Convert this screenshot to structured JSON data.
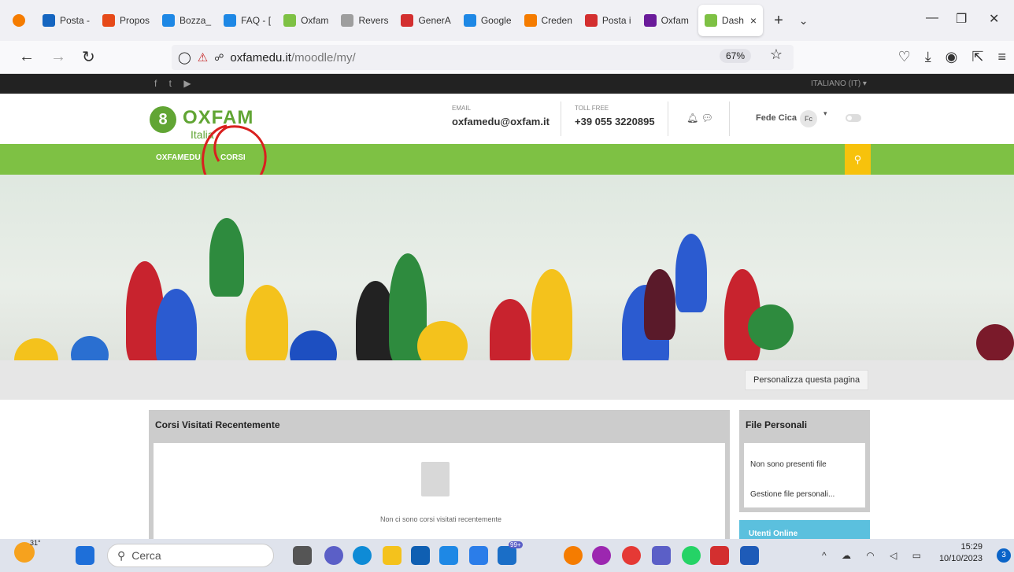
{
  "browser": {
    "tabs": [
      {
        "label": "Posta -",
        "color": "#1565c0"
      },
      {
        "label": "Propos",
        "color": "#e64a19"
      },
      {
        "label": "Bozza_",
        "color": "#1e88e5"
      },
      {
        "label": "FAQ - [",
        "color": "#1e88e5"
      },
      {
        "label": "Oxfam",
        "color": "#7ec144"
      },
      {
        "label": "Revers",
        "color": "#9e9e9e"
      },
      {
        "label": "GenerA",
        "color": "#d32f2f"
      },
      {
        "label": "Google",
        "color": "#1e88e5"
      },
      {
        "label": "Creden",
        "color": "#f57c00"
      },
      {
        "label": "Posta i",
        "color": "#d32f2f"
      },
      {
        "label": "Oxfam",
        "color": "#6a1b9a"
      },
      {
        "label": "Dash",
        "color": "#7ec144"
      }
    ],
    "close_tab": "×",
    "new_tab": "+",
    "tab_list": "⌄",
    "url_host": "oxfamedu.it",
    "url_path": "/moodle/my/",
    "zoom": "67%"
  },
  "site": {
    "language": "ITALIANO (IT) ▾",
    "logo_name": "OXFAM",
    "logo_sub": "Italia",
    "email_label": "EMAIL",
    "email_value": "oxfamedu@oxfam.it",
    "tollfree_label": "TOLL FREE",
    "tollfree_value": "+39 055 3220895",
    "user_name": "Fede Cica",
    "user_initials": "Fc",
    "menu": [
      "OXFAMEDU",
      "CORSI"
    ],
    "customize_button": "Personalizza questa pagina"
  },
  "blocks": {
    "recent_title": "Corsi Visitati Recentemente",
    "recent_empty": "Non ci sono corsi visitati recentemente",
    "files_title": "File Personali",
    "files_empty": "Non sono presenti file",
    "files_manage": "Gestione file personali...",
    "online_title": "Utenti Online"
  },
  "taskbar": {
    "search_placeholder": "Cerca",
    "temperature": "31°",
    "time": "15:29",
    "date": "10/10/2023",
    "notifications": "3",
    "mail_badge": "99+"
  }
}
